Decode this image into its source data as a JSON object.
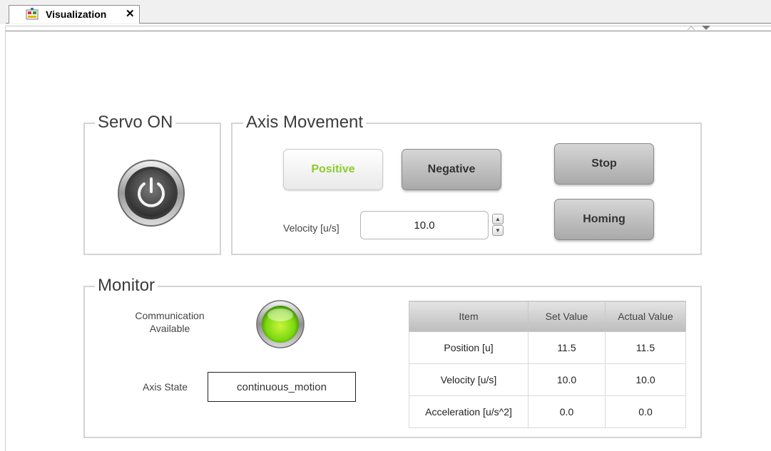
{
  "tab": {
    "label": "Visualization",
    "close": "✕"
  },
  "servo": {
    "title": "Servo ON"
  },
  "axis": {
    "title": "Axis Movement",
    "positive": "Positive",
    "negative": "Negative",
    "stop": "Stop",
    "homing": "Homing",
    "velocity_label": "Velocity [u/s]",
    "velocity_value": "10.0"
  },
  "monitor": {
    "title": "Monitor",
    "comm_label_1": "Communication",
    "comm_label_2": "Available",
    "state_label": "Axis State",
    "state_value": "continuous_motion",
    "table": {
      "headers": [
        "Item",
        "Set Value",
        "Actual Value"
      ],
      "rows": [
        [
          "Position [u]",
          "11.5",
          "11.5"
        ],
        [
          "Velocity [u/s]",
          "10.0",
          "10.0"
        ],
        [
          "Acceleration [u/s^2]",
          "0.0",
          "0.0"
        ]
      ]
    }
  },
  "colors": {
    "positive_text": "#8ccc2a",
    "led": "#7cd90f"
  }
}
